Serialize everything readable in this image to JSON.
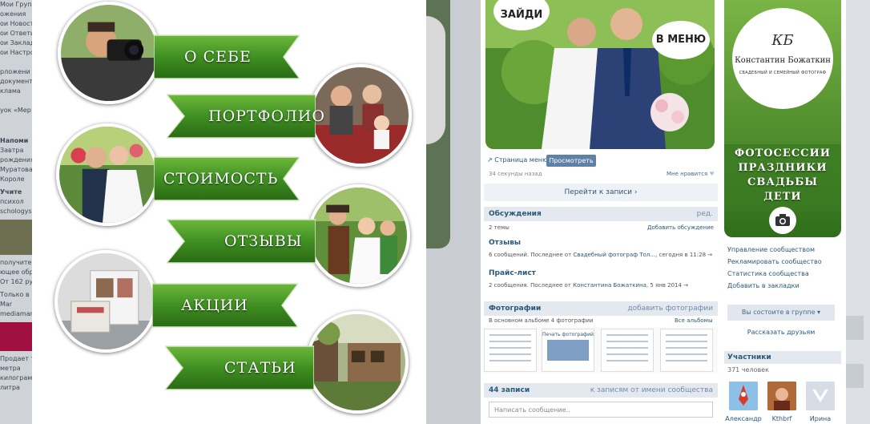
{
  "left_background": {
    "lines": [
      "Мои Группы",
      "ожения",
      "ои Новост",
      "ои Ответы",
      "ои Заклад",
      "ои Настро",
      "",
      "рложени",
      "документы",
      "клама",
      "",
      "уок «Мер"
    ],
    "section1": "Напоми",
    "text1": [
      "Завтра",
      "рождения",
      "Муратова,",
      "Короле"
    ],
    "section2": "Учите",
    "text2": [
      "психол",
      "schologys"
    ],
    "text3": [
      "получите у",
      "ющее обр",
      "От 162 руб"
    ],
    "text4": [
      "Только в",
      "Mar",
      "mediamar"
    ],
    "text5": [
      "Продает т",
      "метра",
      "килограм",
      "литра"
    ]
  },
  "menu": {
    "items": [
      {
        "label": "О СЕБЕ"
      },
      {
        "label": "ПОРТФОЛИО"
      },
      {
        "label": "СТОИМОСТЬ"
      },
      {
        "label": "ОТЗЫВЫ"
      },
      {
        "label": "АКЦИИ"
      },
      {
        "label": "СТАТЬИ"
      }
    ]
  },
  "feed": {
    "bubble_find": "ЗАЙДИ",
    "bubble_menu": "В МЕНЮ",
    "page_label": "Страница меню",
    "view_button": "Просмотреть",
    "time_ago": "34 секунды назад",
    "like": "Мне нравится",
    "goto_post": "Перейти к записи",
    "discussions": {
      "title": "Обсуждения",
      "edit": "ред.",
      "topics_count": "2 темы",
      "add": "Добавить обсуждение",
      "items": [
        {
          "title": "Отзывы",
          "meta_prefix": "6 сообщений. Последнее от",
          "author": "Свадебный фотограф Тол...",
          "time": ", сегодня в 11:28"
        },
        {
          "title": "Прайс-лист",
          "meta_prefix": "2 сообщения. Последнее от",
          "author": "Константина Божаткина",
          "time": ", 5 янв 2014"
        }
      ]
    },
    "photos": {
      "title": "Фотографии",
      "add": "добавить фотографии",
      "album_info": "В основном альбоме 4 фотографии",
      "all_albums": "Все альбомы",
      "thumb_title": "Печать фотографий"
    },
    "posts": {
      "count": "44 записи",
      "filter": "к записям от имени сообщества",
      "placeholder": "Написать сообщение.."
    }
  },
  "side": {
    "monogram": "КБ",
    "name": "Константин Божаткин",
    "subtitle": "СВАДЕБНЫЙ И СЕМЕЙНЫЙ ФОТОГРАФ",
    "cover_lines": [
      "ФОТОСЕССИИ",
      "ПРАЗДНИКИ",
      "СВАДЬБЫ",
      "ДЕТИ"
    ],
    "links": [
      "Управление сообществом",
      "Рекламировать сообщество",
      "Статистика сообщества",
      "Добавить в закладки"
    ],
    "member_button": "Вы состоите в группе",
    "tell_friends": "Рассказать друзьям",
    "members_title": "Участники",
    "members_count": "371 человек",
    "members": [
      {
        "name": "Александр"
      },
      {
        "name": "Kthbrf"
      },
      {
        "name": "Ирина"
      }
    ]
  },
  "colors": {
    "ribbon_green": "#3d8a1e",
    "vk_blue": "#2b587a",
    "header_bg": "#e4e9ef"
  }
}
